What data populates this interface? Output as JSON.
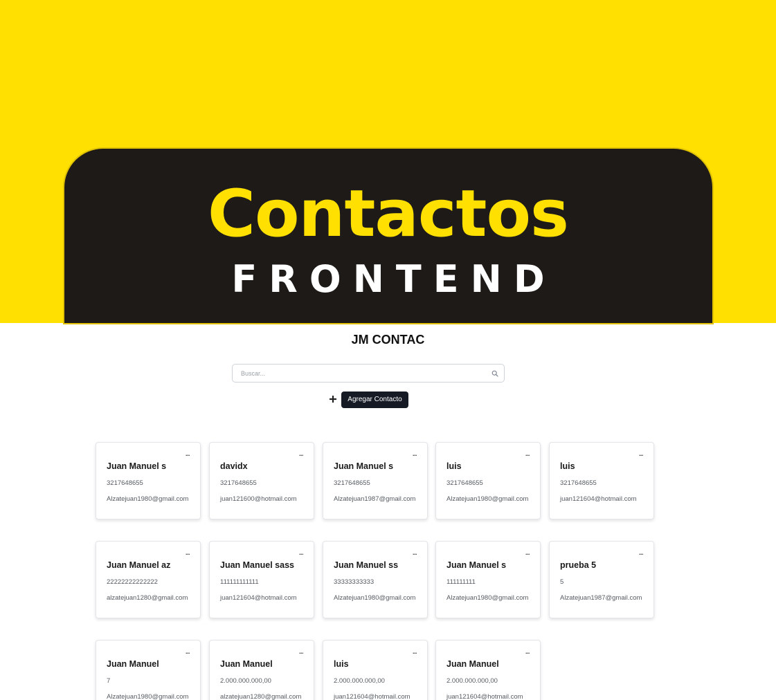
{
  "banner": {
    "title": "Contactos",
    "subtitle": "FRONTEND"
  },
  "app": {
    "title": "JM CONTAC"
  },
  "search": {
    "placeholder": "Buscar..."
  },
  "actions": {
    "add_icon": "plus-icon",
    "add_label": "Agregar Contacto"
  },
  "colors": {
    "banner_background": "#ffe000",
    "banner_panel": "#1d1a18",
    "title_accent": "#ffe000",
    "button_background": "#151a25"
  },
  "contacts": [
    {
      "name": "Juan Manuel s",
      "phone": "3217648655",
      "email": "Alzatejuan1980@gmail.com",
      "menu": "..."
    },
    {
      "name": "davidx",
      "phone": "3217648655",
      "email": "juan121600@hotmail.com",
      "menu": "..."
    },
    {
      "name": "Juan Manuel s",
      "phone": "3217648655",
      "email": "Alzatejuan1987@gmail.com",
      "menu": "..."
    },
    {
      "name": "luis",
      "phone": "3217648655",
      "email": "Alzatejuan1980@gmail.com",
      "menu": "..."
    },
    {
      "name": "luis",
      "phone": "3217648655",
      "email": "juan121604@hotmail.com",
      "menu": "..."
    },
    {
      "name": "Juan Manuel az",
      "phone": "22222222222222",
      "email": "alzatejuan1280@gmail.com",
      "menu": "..."
    },
    {
      "name": "Juan Manuel sass",
      "phone": "111111111111",
      "email": "juan121604@hotmail.com",
      "menu": "..."
    },
    {
      "name": "Juan Manuel ss",
      "phone": "33333333333",
      "email": "Alzatejuan1980@gmail.com",
      "menu": "..."
    },
    {
      "name": "Juan Manuel s",
      "phone": "111111111",
      "email": "Alzatejuan1980@gmail.com",
      "menu": "..."
    },
    {
      "name": "prueba 5",
      "phone": "5",
      "email": "Alzatejuan1987@gmail.com",
      "menu": "..."
    },
    {
      "name": "Juan Manuel",
      "phone": "7",
      "email": "Alzatejuan1980@gmail.com",
      "menu": "..."
    },
    {
      "name": "Juan Manuel",
      "phone": "2.000.000.000,00",
      "email": "alzatejuan1280@gmail.com",
      "menu": "..."
    },
    {
      "name": "luis",
      "phone": "2.000.000.000,00",
      "email": "juan121604@hotmail.com",
      "menu": "..."
    },
    {
      "name": "Juan Manuel",
      "phone": "2.000.000.000,00",
      "email": "juan121604@hotmail.com",
      "menu": "..."
    }
  ]
}
